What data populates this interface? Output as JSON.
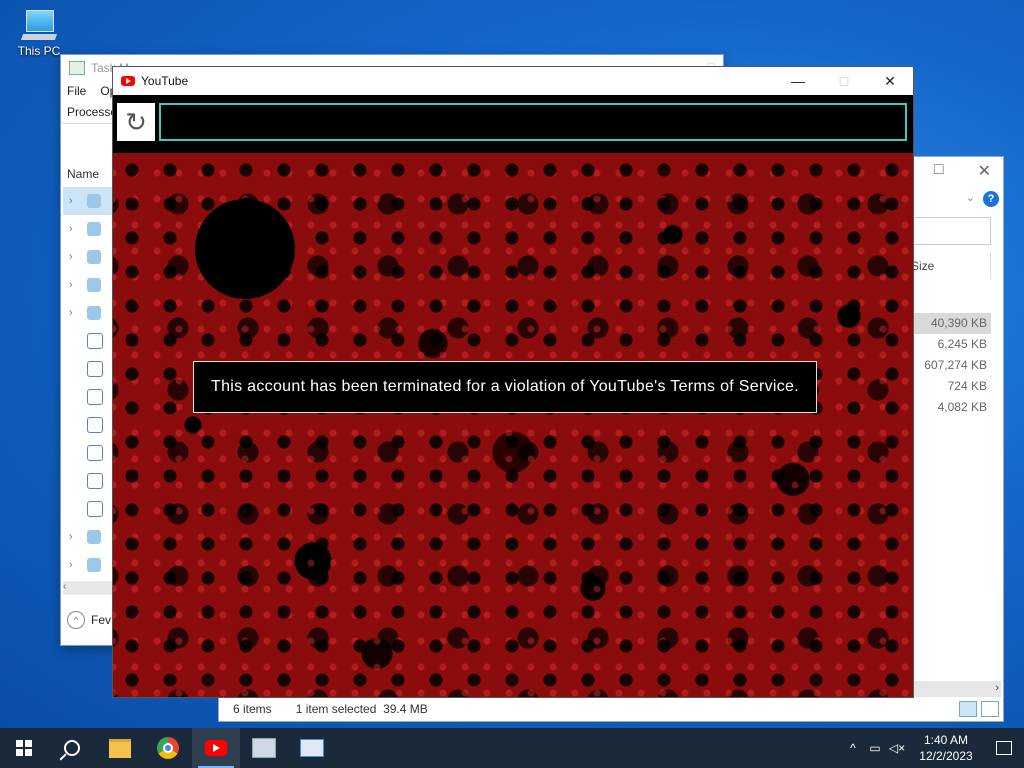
{
  "desktop": {
    "icon_label": "This PC"
  },
  "task_manager": {
    "title": "Task M",
    "menu": [
      "File",
      "Op"
    ],
    "tab": "Processe",
    "column": "Name",
    "fewer": "Fev"
  },
  "explorer": {
    "column_size": "Size",
    "sizes": [
      "40,390 KB",
      "6,245 KB",
      "607,274 KB",
      "724 KB",
      "4,082 KB"
    ],
    "status_items": "6 items",
    "status_selected": "1 item selected",
    "status_size": "39.4 MB"
  },
  "youtube": {
    "title": "YouTube",
    "message": "This account has been terminated for a violation of YouTube's Terms of Service."
  },
  "taskbar": {
    "time": "1:40 AM",
    "date": "12/2/2023"
  }
}
